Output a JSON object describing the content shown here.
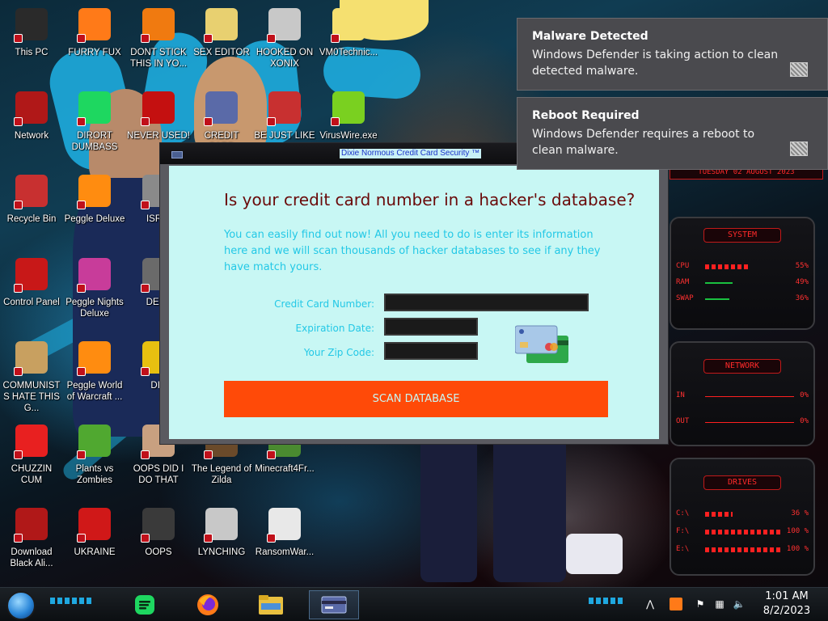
{
  "desktop": {
    "icons": [
      {
        "label": "This PC",
        "icon": "computer-icon",
        "color": "#2a2a2a"
      },
      {
        "label": "FURRY FUX",
        "icon": "firefox-icon",
        "color": "#ff7a18"
      },
      {
        "label": "DONT STICK THIS IN YO...",
        "icon": "vlc-cone-icon",
        "color": "#f07a10"
      },
      {
        "label": "SEX EDITOR",
        "icon": "hxd-editor-icon",
        "color": "#e8d070"
      },
      {
        "label": "HOOKED ON XONIX",
        "icon": "xonix-game-icon",
        "color": "#c8c8c8"
      },
      {
        "label": "VM0Technic...",
        "icon": "cartoon-face-icon",
        "color": "#f5e070"
      },
      {
        "label": "Network",
        "icon": "network-orb-icon",
        "color": "#b01818"
      },
      {
        "label": "DIRORT DUMBASS",
        "icon": "spotify-icon",
        "color": "#1ed760"
      },
      {
        "label": "NEVER USED!",
        "icon": "dev-cpp-icon",
        "color": "#c41010"
      },
      {
        "label": "CREDIT CARD",
        "icon": "credit-card-icon",
        "color": "#5a6aa8"
      },
      {
        "label": "BE JUST LIKE",
        "icon": "santa-icon",
        "color": "#c83030"
      },
      {
        "label": "VirusWire.exe",
        "icon": "lime-icon",
        "color": "#7ad020"
      },
      {
        "label": "Recycle Bin",
        "icon": "recycle-bin-icon",
        "color": "#c83030"
      },
      {
        "label": "Peggle Deluxe",
        "icon": "peggle-icon",
        "color": "#ff8c10"
      },
      {
        "label": "ISRAI",
        "icon": "unknown-app-icon",
        "color": "#8a8a8a"
      },
      {
        "label": "Control Panel",
        "icon": "control-panel-icon",
        "color": "#c81818"
      },
      {
        "label": "Peggle Nights Deluxe",
        "icon": "peggle-nights-icon",
        "color": "#c83c9a"
      },
      {
        "label": "DEEZ",
        "icon": "printer-icon",
        "color": "#6a6a6a"
      },
      {
        "label": "COMMUNISTS HATE THIS G...",
        "icon": "money-bag-icon",
        "color": "#c8a060"
      },
      {
        "label": "Peggle World of Warcraft ...",
        "icon": "peggle-wow-icon",
        "color": "#ff8c10"
      },
      {
        "label": "DIE",
        "icon": "dll-file-icon",
        "color": "#e8c010"
      },
      {
        "label": "CHUZZIN CUM",
        "icon": "chuzzle-icon",
        "color": "#e82020"
      },
      {
        "label": "Plants vs Zombies",
        "icon": "pvz-flower-icon",
        "color": "#50a830"
      },
      {
        "label": "OOPS DID I DO THAT",
        "icon": "hitman-icon",
        "color": "#c8a080"
      },
      {
        "label": "The Legend of Zilda",
        "icon": "zelda-icon",
        "color": "#6a4a2a"
      },
      {
        "label": "Minecraft4Fr...",
        "icon": "minecraft-icon",
        "color": "#4a8a30"
      },
      {
        "label": "Download Black Ali...",
        "icon": "download-orb-icon",
        "color": "#b01818"
      },
      {
        "label": "UKRAINE",
        "icon": "radiation-icon",
        "color": "#d01818"
      },
      {
        "label": "OOPS",
        "icon": "warning-book-icon",
        "color": "#3a3a3a"
      },
      {
        "label": "LYNCHING",
        "icon": "noose-icon",
        "color": "#c8c8c8"
      },
      {
        "label": "RansomWar...",
        "icon": "skull-icon",
        "color": "#e8e8e8"
      }
    ]
  },
  "gadget": {
    "date": "TUESDAY 02 AUGUST 2023",
    "system": {
      "title": "SYSTEM",
      "rows": [
        {
          "label": "CPU",
          "value": "55%",
          "level": 0.55
        },
        {
          "label": "RAM",
          "value": "49%",
          "level": 0.49
        },
        {
          "label": "SWAP",
          "value": "36%",
          "level": 0.36
        }
      ]
    },
    "network": {
      "title": "NETWORK",
      "rows": [
        {
          "label": "IN",
          "value": "0%"
        },
        {
          "label": "OUT",
          "value": "0%"
        }
      ]
    },
    "drives": {
      "title": "DRIVES",
      "rows": [
        {
          "label": "C:\\",
          "value": "36 %",
          "level": 0.36
        },
        {
          "label": "F:\\",
          "value": "100 %",
          "level": 1.0
        },
        {
          "label": "E:\\",
          "value": "100 %",
          "level": 1.0
        }
      ]
    }
  },
  "window": {
    "title": "Dixie Normous Credit Card Security ™",
    "headline": "Is your credit card number in a hacker's database?",
    "intro": "You can easily find out now! All you need to do is enter its information here and we will scan thousands of hacker databases to see if any they have match yours.",
    "fields": {
      "card_number": {
        "label": "Credit Card Number:",
        "value": ""
      },
      "expiration": {
        "label": "Expiration Date:",
        "value": ""
      },
      "zip": {
        "label": "Your Zip Code:",
        "value": ""
      }
    },
    "scan_button": "SCAN DATABASE",
    "colors": {
      "background": "#c8f7f4",
      "headline": "#6a0a0a",
      "text": "#23c8e6",
      "button": "#ff4a08"
    }
  },
  "notifications": [
    {
      "title": "Malware Detected",
      "body": "Windows Defender is taking action to clean detected malware."
    },
    {
      "title": "Reboot Required",
      "body": "Windows Defender requires a reboot to clean malware."
    }
  ],
  "taskbar": {
    "apps": [
      {
        "name": "spotify",
        "icon": "spotify-icon"
      },
      {
        "name": "firefox",
        "icon": "firefox-icon"
      },
      {
        "name": "file-explorer",
        "icon": "folder-icon"
      },
      {
        "name": "credit-card-app",
        "icon": "credit-card-icon",
        "active": true
      }
    ],
    "clock": {
      "time": "1:01 AM",
      "date": "8/2/2023"
    }
  }
}
